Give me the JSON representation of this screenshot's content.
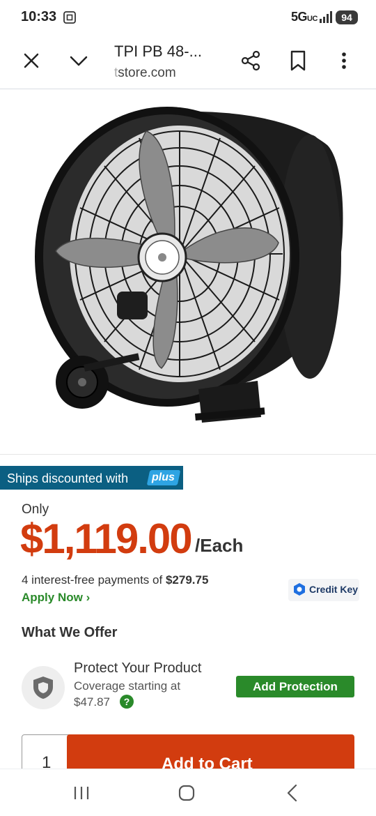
{
  "status_bar": {
    "time": "10:33",
    "network": "5G",
    "network_suffix": "UC",
    "battery": "94"
  },
  "browser": {
    "title": "TPI PB 48-...",
    "url_faded": "t",
    "url_main": "store.com"
  },
  "product": {
    "image_alt_icon": "drum-fan-image"
  },
  "ships_banner": {
    "text": "Ships discounted with",
    "badge": "plus"
  },
  "pricing": {
    "only_label": "Only",
    "price": "$1,119.00",
    "unit": "/Each",
    "installments_prefix": "4 interest-free payments of",
    "installment_amount": "$279.75",
    "apply_now": "Apply Now",
    "credit_key": "Credit Key"
  },
  "offer": {
    "section_title": "What We Offer",
    "title": "Protect Your Product",
    "sub_line1": "Coverage starting at",
    "sub_line2": "$47.87",
    "help": "?",
    "button": "Add Protection"
  },
  "cart": {
    "quantity": "1",
    "button": "Add to Cart"
  },
  "colors": {
    "price_orange": "#d23c0f",
    "green": "#2a8a2a",
    "banner_blue": "#0b5f82",
    "plus_blue": "#2ea4e3"
  }
}
